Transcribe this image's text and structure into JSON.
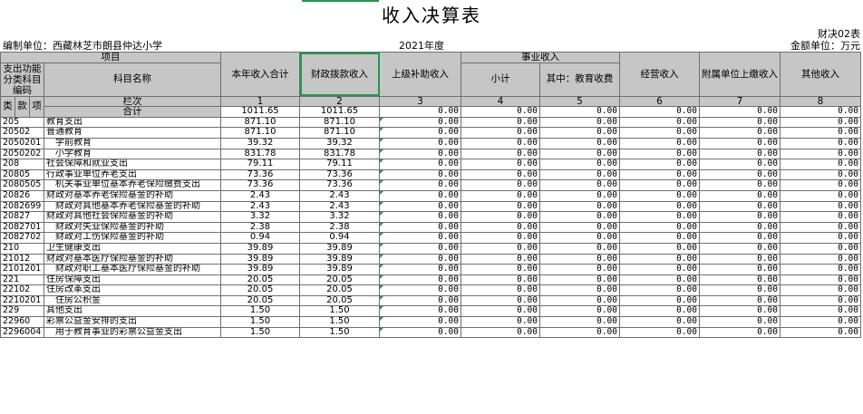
{
  "title": "收入决算表",
  "form_code": "财决02表",
  "unit": "编制单位：西藏林芝市朗县仲达小学",
  "year": "2021年度",
  "amount_unit": "金额单位：万元",
  "headers": {
    "item": "项目",
    "func_code": "支出功能分类科目编码",
    "subject_name": "科目名称",
    "lei": "类",
    "kuan": "款",
    "xiang": "项",
    "col_label": "栏次",
    "total_label": "合计",
    "income_total": "本年收入合计",
    "fiscal": "财政拨款收入",
    "superior": "上级补助收入",
    "career": "事业收入",
    "subtotal": "小计",
    "edu_fee": "其中：教育收费",
    "operating": "经营收入",
    "affiliated": "附属单位上缴收入",
    "other": "其他收入"
  },
  "col_numbers": [
    "1",
    "2",
    "3",
    "4",
    "5",
    "6",
    "7",
    "8"
  ],
  "total_row": [
    "1011.65",
    "1011.65",
    "0.00",
    "0.00",
    "0.00",
    "0.00",
    "0.00",
    "0.00"
  ],
  "rows": [
    {
      "code": "205",
      "name": "教育支出",
      "vals": [
        "871.10",
        "871.10",
        "0.00",
        "0.00",
        "0.00",
        "0.00",
        "0.00",
        "0.00"
      ]
    },
    {
      "code": "20502",
      "name": "普通教育",
      "vals": [
        "871.10",
        "871.10",
        "0.00",
        "0.00",
        "0.00",
        "0.00",
        "0.00",
        "0.00"
      ]
    },
    {
      "code": "2050201",
      "name": "学前教育",
      "vals": [
        "39.32",
        "39.32",
        "0.00",
        "0.00",
        "0.00",
        "0.00",
        "0.00",
        "0.00"
      ]
    },
    {
      "code": "2050202",
      "name": "小学教育",
      "vals": [
        "831.78",
        "831.78",
        "0.00",
        "0.00",
        "0.00",
        "0.00",
        "0.00",
        "0.00"
      ]
    },
    {
      "code": "208",
      "name": "社会保障和就业支出",
      "vals": [
        "79.11",
        "79.11",
        "0.00",
        "0.00",
        "0.00",
        "0.00",
        "0.00",
        "0.00"
      ]
    },
    {
      "code": "20805",
      "name": "行政事业单位养老支出",
      "vals": [
        "73.36",
        "73.36",
        "0.00",
        "0.00",
        "0.00",
        "0.00",
        "0.00",
        "0.00"
      ]
    },
    {
      "code": "2080505",
      "name": "机关事业单位基本养老保险缴费支出",
      "vals": [
        "73.36",
        "73.36",
        "0.00",
        "0.00",
        "0.00",
        "0.00",
        "0.00",
        "0.00"
      ]
    },
    {
      "code": "20826",
      "name": "财政对基本养老保险基金的补助",
      "vals": [
        "2.43",
        "2.43",
        "0.00",
        "0.00",
        "0.00",
        "0.00",
        "0.00",
        "0.00"
      ]
    },
    {
      "code": "2082699",
      "name": "财政对其他基本养老保险基金的补助",
      "vals": [
        "2.43",
        "2.43",
        "0.00",
        "0.00",
        "0.00",
        "0.00",
        "0.00",
        "0.00"
      ]
    },
    {
      "code": "20827",
      "name": "财政对其他社会保险基金的补助",
      "vals": [
        "3.32",
        "3.32",
        "0.00",
        "0.00",
        "0.00",
        "0.00",
        "0.00",
        "0.00"
      ]
    },
    {
      "code": "2082701",
      "name": "财政对失业保险基金的补助",
      "vals": [
        "2.38",
        "2.38",
        "0.00",
        "0.00",
        "0.00",
        "0.00",
        "0.00",
        "0.00"
      ]
    },
    {
      "code": "2082702",
      "name": "财政对工伤保险基金的补助",
      "vals": [
        "0.94",
        "0.94",
        "0.00",
        "0.00",
        "0.00",
        "0.00",
        "0.00",
        "0.00"
      ]
    },
    {
      "code": "210",
      "name": "卫生健康支出",
      "vals": [
        "39.89",
        "39.89",
        "0.00",
        "0.00",
        "0.00",
        "0.00",
        "0.00",
        "0.00"
      ]
    },
    {
      "code": "21012",
      "name": "财政对基本医疗保险基金的补助",
      "vals": [
        "39.89",
        "39.89",
        "0.00",
        "0.00",
        "0.00",
        "0.00",
        "0.00",
        "0.00"
      ]
    },
    {
      "code": "2101201",
      "name": "财政对职工基本医疗保险基金的补助",
      "vals": [
        "39.89",
        "39.89",
        "0.00",
        "0.00",
        "0.00",
        "0.00",
        "0.00",
        "0.00"
      ]
    },
    {
      "code": "221",
      "name": "住房保障支出",
      "vals": [
        "20.05",
        "20.05",
        "0.00",
        "0.00",
        "0.00",
        "0.00",
        "0.00",
        "0.00"
      ]
    },
    {
      "code": "22102",
      "name": "住房改革支出",
      "vals": [
        "20.05",
        "20.05",
        "0.00",
        "0.00",
        "0.00",
        "0.00",
        "0.00",
        "0.00"
      ]
    },
    {
      "code": "2210201",
      "name": "住房公积金",
      "vals": [
        "20.05",
        "20.05",
        "0.00",
        "0.00",
        "0.00",
        "0.00",
        "0.00",
        "0.00"
      ]
    },
    {
      "code": "229",
      "name": "其他支出",
      "vals": [
        "1.50",
        "1.50",
        "0.00",
        "0.00",
        "0.00",
        "0.00",
        "0.00",
        "0.00"
      ]
    },
    {
      "code": "22960",
      "name": "彩票公益金安排的支出",
      "vals": [
        "1.50",
        "1.50",
        "0.00",
        "0.00",
        "0.00",
        "0.00",
        "0.00",
        "0.00"
      ]
    },
    {
      "code": "2296004",
      "name": "用于教育事业的彩票公益金支出",
      "vals": [
        "1.50",
        "1.50",
        "0.00",
        "0.00",
        "0.00",
        "0.00",
        "0.00",
        "0.00"
      ]
    }
  ]
}
